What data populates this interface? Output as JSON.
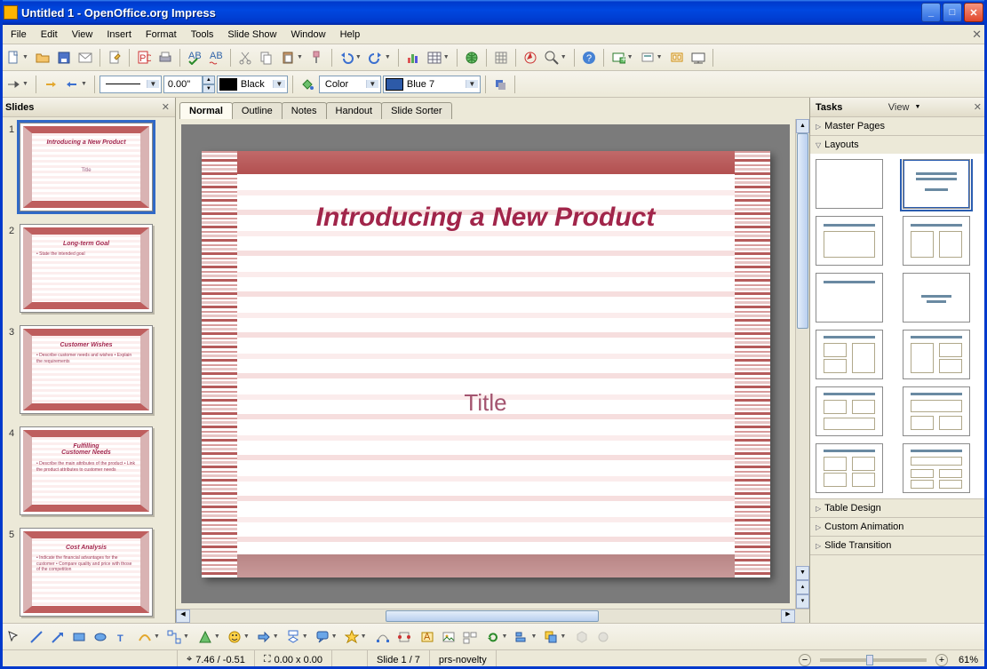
{
  "window": {
    "title": "Untitled 1 - OpenOffice.org Impress"
  },
  "menu": [
    "File",
    "Edit",
    "View",
    "Insert",
    "Format",
    "Tools",
    "Slide Show",
    "Window",
    "Help"
  ],
  "toolbar2": {
    "line_width": "0.00\"",
    "line_color_label": "Black",
    "fill_mode": "Color",
    "fill_color_label": "Blue 7"
  },
  "view_tabs": [
    "Normal",
    "Outline",
    "Notes",
    "Handout",
    "Slide Sorter"
  ],
  "active_view_tab": "Normal",
  "slide": {
    "heading": "Introducing a New Product",
    "subtitle": "Title"
  },
  "slides_panel": {
    "title": "Slides",
    "items": [
      {
        "title": "Introducing a New Product",
        "sub": "Title",
        "body": ""
      },
      {
        "title": "Long-term Goal",
        "sub": "",
        "body": "• State the intended goal"
      },
      {
        "title": "Customer Wishes",
        "sub": "",
        "body": "• Describe customer needs and wishes\n• Explain the requirements"
      },
      {
        "title": "Fulfilling\nCustomer Needs",
        "sub": "",
        "body": "• Describe the main attributes of the product\n• Link the product attributes to customer needs"
      },
      {
        "title": "Cost Analysis",
        "sub": "",
        "body": "• Indicate the financial advantages for the customer\n• Compare quality and price with those of the competition"
      }
    ]
  },
  "tasks_panel": {
    "title": "Tasks",
    "view_label": "View",
    "sections": {
      "master": "Master Pages",
      "layouts": "Layouts",
      "table": "Table Design",
      "anim": "Custom Animation",
      "trans": "Slide Transition"
    }
  },
  "status": {
    "coords": "7.46 / -0.51",
    "size": "0.00 x 0.00",
    "slide": "Slide 1 / 7",
    "template": "prs-novelty",
    "zoom": "61%"
  },
  "colors": {
    "black": "#000000",
    "blue7": "#2d5aa8"
  }
}
